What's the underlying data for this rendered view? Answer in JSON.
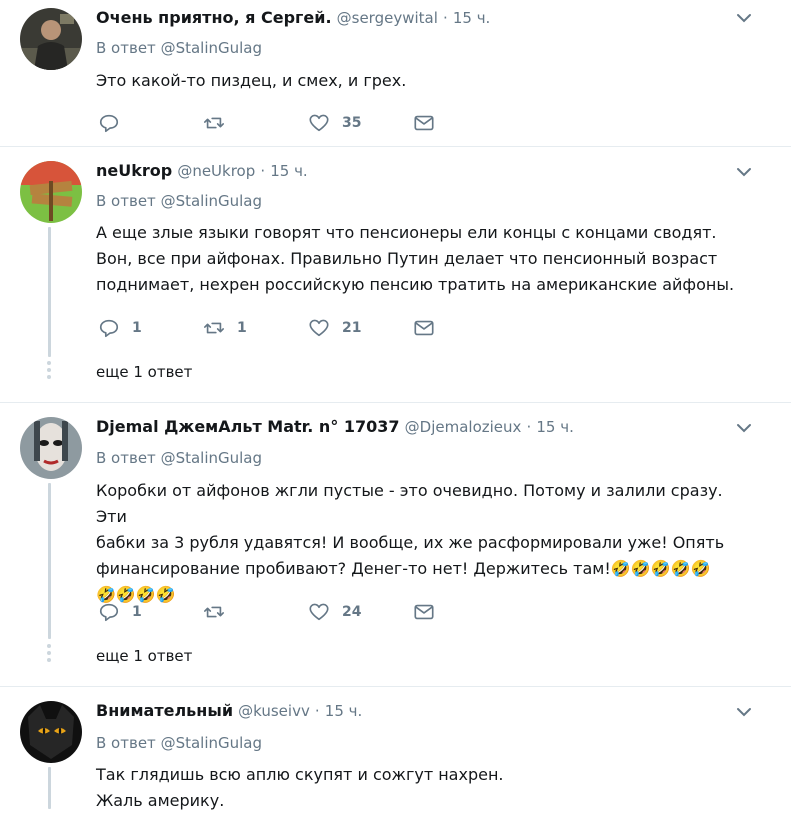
{
  "common": {
    "reply_to_prefix": "В ответ",
    "more_replies": "еще 1 ответ"
  },
  "tweets": [
    {
      "name": "Очень приятно, я Сергей.",
      "handle": "@sergeywital",
      "sep": "·",
      "time": "15 ч.",
      "reply_to": "@StalinGulag",
      "lines": [
        "Это какой-то пиздец, и смех, и грех."
      ],
      "replies": "",
      "retweets": "",
      "likes": "35"
    },
    {
      "name": "neUkrop",
      "handle": "@neUkrop",
      "sep": "·",
      "time": "15 ч.",
      "reply_to": "@StalinGulag",
      "lines": [
        "А еще злые языки говорят что пенсионеры ели концы с концами сводят.",
        "Вон, все при айфонах. Правильно Путин делает что пенсионный возраст",
        "поднимает, нехрен российскую пенсию тратить на американские айфоны."
      ],
      "replies": "1",
      "retweets": "1",
      "likes": "21"
    },
    {
      "name": "Djemal ДжемАльт Matr. n° 17037",
      "handle": "@Djemalozieux",
      "sep": "·",
      "time": "15 ч.",
      "reply_to": "@StalinGulag",
      "lines": [
        "Коробки от айфонов жгли пустые - это очевидно. Потому и залили сразу. Эти",
        "бабки за 3 рубля удавятся! И вообще, их же расформировали уже! Опять",
        "финансирование пробивают? Денег-то нет! Держитесь там!🤣🤣🤣🤣🤣",
        "🤣🤣🤣🤣"
      ],
      "replies": "1",
      "retweets": "",
      "likes": "24"
    },
    {
      "name": "Внимательный",
      "handle": "@kuseivv",
      "sep": "·",
      "time": "15 ч.",
      "reply_to": "@StalinGulag",
      "lines": [
        "Так глядишь всю аплю скупят и сожгут нахрен.",
        "Жаль америку."
      ],
      "replies": "",
      "retweets": "",
      "likes": ""
    }
  ]
}
